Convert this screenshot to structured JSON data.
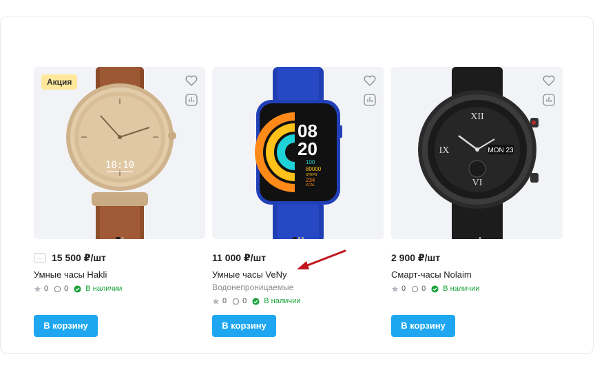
{
  "products": [
    {
      "badge": "Акция",
      "price": "15 500 ₽/шт",
      "title": "Умные часы Hakli",
      "rating": "0",
      "comments": "0",
      "stock": "В наличии",
      "cart_label": "В корзину",
      "watch_time": "10:10"
    },
    {
      "price": "11 000 ₽/шт",
      "title": "Умные часы VeNy",
      "subtitle": "Водонепроницаемые",
      "rating": "0",
      "comments": "0",
      "stock": "В наличии",
      "cart_label": "В корзину",
      "screen_hour": "08",
      "screen_min": "20",
      "screen_v1": "100",
      "screen_v2": "80000",
      "screen_v2_label": "STEPS",
      "screen_v3": "234",
      "screen_v3_label": "KCAL"
    },
    {
      "price": "2 900 ₽/шт",
      "title": "Смарт-часы Nolaim",
      "rating": "0",
      "comments": "0",
      "stock": "В наличии",
      "cart_label": "В корзину",
      "dial_date": "MON 23"
    }
  ],
  "colors": {
    "accent": "#1ea7f0",
    "badge_bg": "#ffe79b",
    "in_stock": "#1aa33a",
    "annotation_arrow": "#c0161c"
  }
}
